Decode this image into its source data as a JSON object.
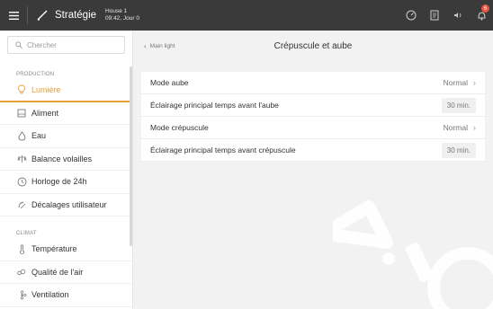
{
  "topbar": {
    "app_title": "Stratégie",
    "house_name": "House 1",
    "house_sub": "09:42, Jour 0",
    "notification_count": "6"
  },
  "sidebar": {
    "search_placeholder": "Chercher",
    "sections": [
      {
        "label": "PRODUCTION",
        "items": [
          {
            "label": "Lumière",
            "icon": "bulb-icon",
            "active": true
          },
          {
            "label": "Aliment",
            "icon": "feed-icon"
          },
          {
            "label": "Eau",
            "icon": "water-drop-icon"
          },
          {
            "label": "Balance volailles",
            "icon": "scale-icon"
          },
          {
            "label": "Horloge de 24h",
            "icon": "clock-icon"
          },
          {
            "label": "Décalages utilisateur",
            "icon": "sunrise-icon"
          }
        ]
      },
      {
        "label": "CLIMAT",
        "items": [
          {
            "label": "Température",
            "icon": "thermometer-icon"
          },
          {
            "label": "Qualité de l'air",
            "icon": "air-quality-icon"
          },
          {
            "label": "Ventilation",
            "icon": "fan-icon"
          }
        ]
      }
    ]
  },
  "main": {
    "back_label": "Main light",
    "title": "Crépuscule et aube",
    "rows": [
      {
        "label": "Mode aube",
        "value": "Normal",
        "type": "select"
      },
      {
        "label": "Éclairage principal temps avant l'aube",
        "value": "30 min.",
        "type": "input"
      },
      {
        "label": "Mode crépuscule",
        "value": "Normal",
        "type": "select"
      },
      {
        "label": "Éclairage principal temps avant crépuscule",
        "value": "30 min.",
        "type": "input"
      }
    ]
  },
  "colors": {
    "topbar": "#3a3a3a",
    "accent": "#e8a13a",
    "badge": "#e8543f"
  }
}
